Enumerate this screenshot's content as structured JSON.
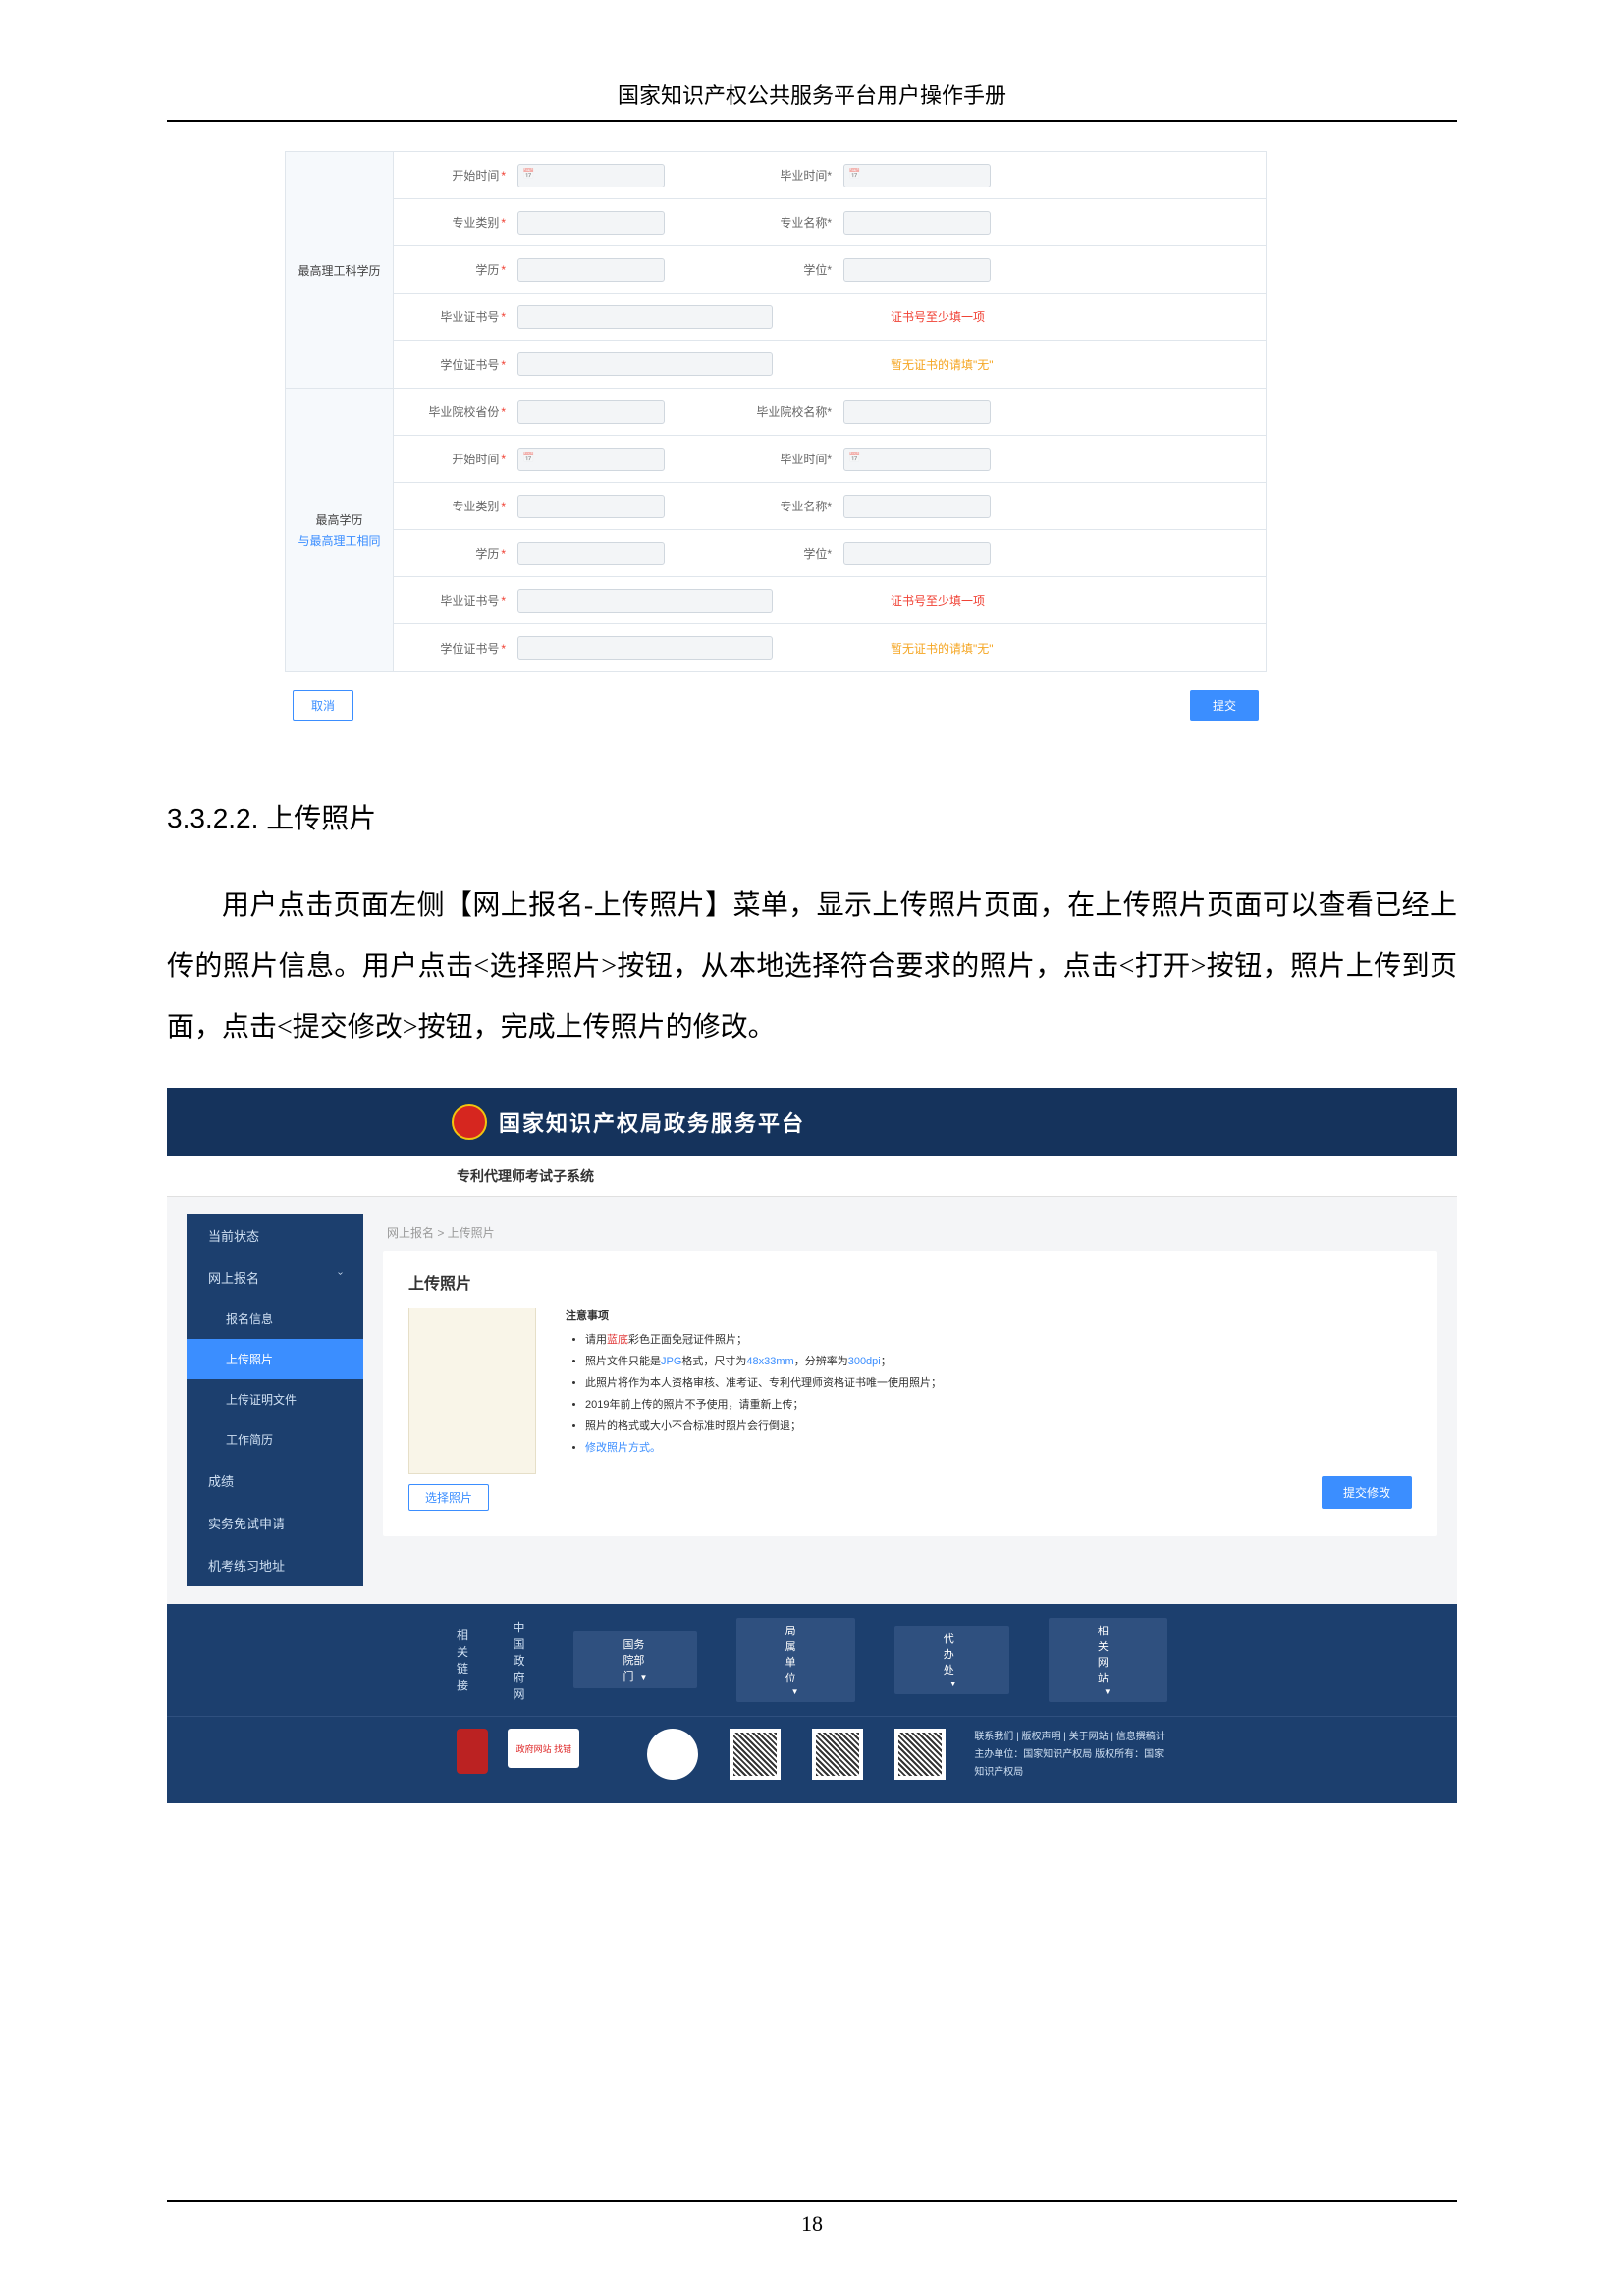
{
  "header": "国家知识产权公共服务平台用户操作手册",
  "page_number": "18",
  "section": {
    "number": "3.3.2.2.",
    "title": "上传照片"
  },
  "body_text": "用户点击页面左侧【网上报名-上传照片】菜单，显示上传照片页面，在上传照片页面可以查看已经上传的照片信息。用户点击<选择照片>按钮，从本地选择符合要求的照片，点击<打开>按钮，照片上传到页面，点击<提交修改>按钮，完成上传照片的修改。",
  "form1": {
    "block1": {
      "label": "最高理工科学历",
      "rows": {
        "r1": {
          "l1": "开始时间",
          "l2": "毕业时间"
        },
        "r2": {
          "l1": "专业类别",
          "l2": "专业名称"
        },
        "r3": {
          "l1": "学历",
          "l2": "学位"
        },
        "r4": {
          "l1": "毕业证书号",
          "hint": "证书号至少填一项"
        },
        "r5": {
          "l1": "学位证书号",
          "hint": "暂无证书的请填\"无\""
        }
      }
    },
    "block2": {
      "label": "最高学历",
      "sublabel": "与最高理工相同",
      "rows": {
        "r0": {
          "l1": "毕业院校省份",
          "l2": "毕业院校名称"
        },
        "r1": {
          "l1": "开始时间",
          "l2": "毕业时间"
        },
        "r2": {
          "l1": "专业类别",
          "l2": "专业名称"
        },
        "r3": {
          "l1": "学历",
          "l2": "学位"
        },
        "r4": {
          "l1": "毕业证书号",
          "hint": "证书号至少填一项"
        },
        "r5": {
          "l1": "学位证书号",
          "hint": "暂无证书的请填\"无\""
        }
      }
    },
    "cancel": "取消",
    "submit": "提交"
  },
  "sc2": {
    "top_title": "国家知识产权局政务服务平台",
    "subtitle": "专利代理师考试子系统",
    "breadcrumb": "网上报名 > 上传照片",
    "sidebar": {
      "s1": "当前状态",
      "s2": "网上报名",
      "s2a": "报名信息",
      "s2b": "上传照片",
      "s2c": "上传证明文件",
      "s2d": "工作简历",
      "s3": "成绩",
      "s4": "实务免试申请",
      "s5": "机考练习地址"
    },
    "card": {
      "title": "上传照片",
      "select_btn": "选择照片",
      "submit_btn": "提交修改",
      "notes_title": "注意事项",
      "n1a": "请用",
      "n1b": "蓝底",
      "n1c": "彩色正面免冠证件照片；",
      "n2a": "照片文件只能是",
      "n2b": "JPG",
      "n2c": "格式，尺寸为",
      "n2d": "48x33mm",
      "n2e": "，分辨率为",
      "n2f": "300dpi",
      "n2g": "；",
      "n3": "此照片将作为本人资格审核、准考证、专利代理师资格证书唯一使用照片；",
      "n4": "2019年前上传的照片不予使用，请重新上传；",
      "n5": "照片的格式或大小不合标准时照片会行倒退；",
      "n6": "修改照片方式。"
    },
    "footer": {
      "links_label": "相关链接",
      "link1": "中国政府网",
      "dd1": "国务院部门",
      "dd2": "局属单位",
      "dd3": "代办处",
      "dd4": "相关网站",
      "badge2a": "政府网站",
      "badge2b": "找错",
      "info1": "联系我们 | 版权声明 | 关于网站 | 信息撰稿计",
      "info2": "主办单位：国家知识产权局    版权所有：国家知识产权局"
    }
  }
}
